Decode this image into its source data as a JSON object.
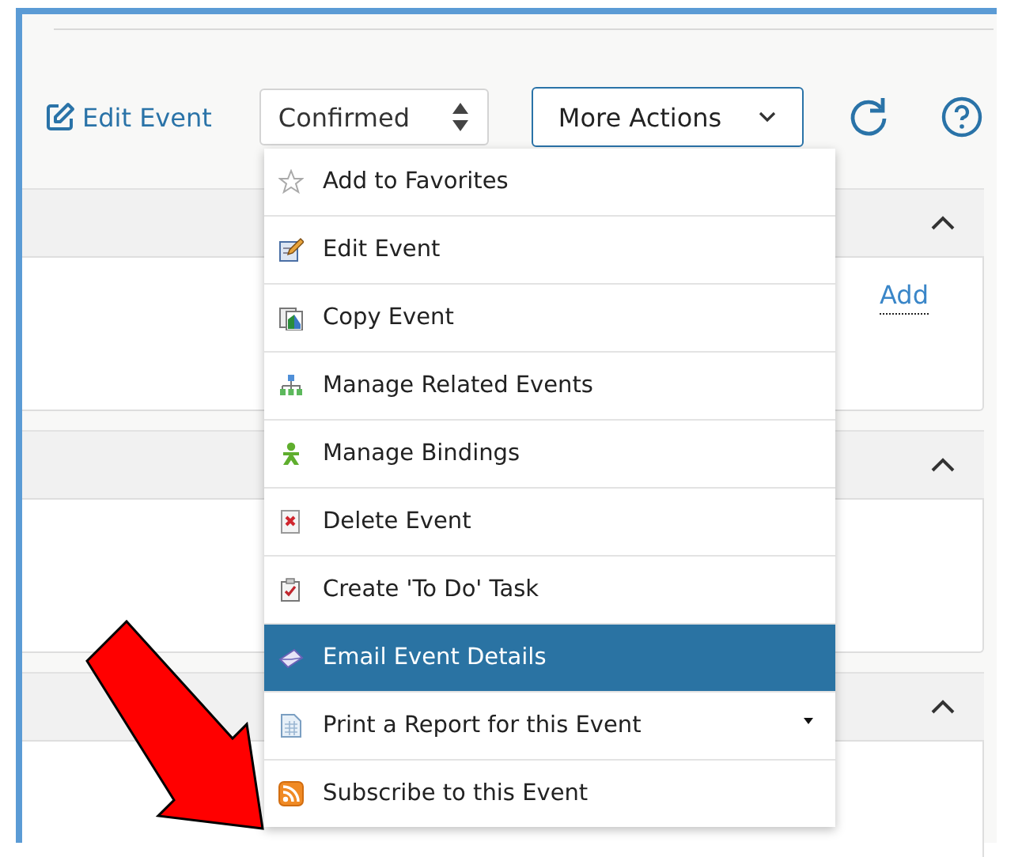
{
  "toolbar": {
    "edit_link": "Edit Event",
    "status_select": {
      "value": "Confirmed"
    },
    "more_actions": {
      "label": "More Actions",
      "expanded": true
    }
  },
  "panels": [
    {
      "expanded": true,
      "link": "Add"
    },
    {
      "expanded": true
    },
    {
      "expanded": true
    }
  ],
  "menu": [
    {
      "kind": "star",
      "label": "Add to Favorites",
      "selected": false
    },
    {
      "kind": "edit",
      "label": "Edit Event",
      "selected": false
    },
    {
      "kind": "copy",
      "label": "Copy Event",
      "selected": false
    },
    {
      "kind": "related",
      "label": "Manage Related Events",
      "selected": false
    },
    {
      "kind": "bindings",
      "label": "Manage Bindings",
      "selected": false
    },
    {
      "kind": "delete",
      "label": "Delete Event",
      "selected": false
    },
    {
      "kind": "todo",
      "label": "Create 'To Do' Task",
      "selected": false
    },
    {
      "kind": "email",
      "label": "Email Event Details",
      "selected": true
    },
    {
      "kind": "report",
      "label": "Print a Report for this Event",
      "selected": false,
      "submenu": true
    },
    {
      "kind": "rss",
      "label": "Subscribe to this Event",
      "selected": false
    }
  ]
}
